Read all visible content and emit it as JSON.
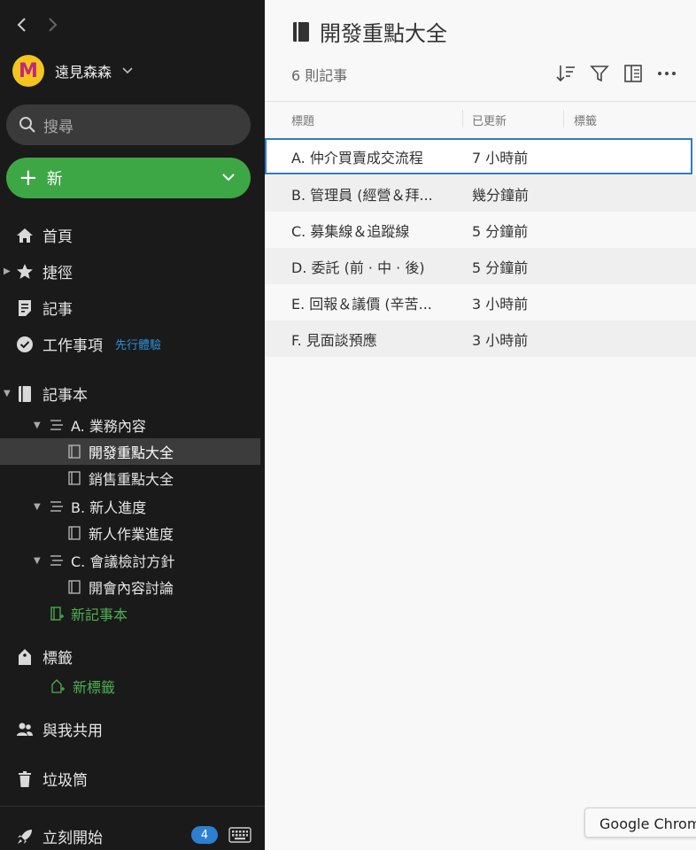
{
  "account": {
    "avatar_letter": "M",
    "name": "遠見森森"
  },
  "search": {
    "placeholder": "搜尋"
  },
  "new_button": {
    "label": "新"
  },
  "nav": {
    "home": "首頁",
    "shortcuts": "捷徑",
    "notes": "記事",
    "tasks": "工作事項",
    "tasks_beta": "先行體驗",
    "notebooks": "記事本",
    "tags": "標籤",
    "new_tag": "新標籤",
    "shared": "與我共用",
    "trash": "垃圾筒",
    "get_started": "立刻開始",
    "get_started_badge": "4"
  },
  "tree": {
    "stack_a": "A. 業務內容",
    "nb_a1": "開發重點大全",
    "nb_a2": "銷售重點大全",
    "stack_b": "B. 新人進度",
    "nb_b1": "新人作業進度",
    "stack_c": "C. 會議檢討方針",
    "nb_c1": "開會內容討論",
    "new_notebook": "新記事本"
  },
  "main": {
    "title": "開發重點大全",
    "note_count": "6 則記事",
    "columns": {
      "title": "標題",
      "updated": "已更新",
      "tags": "標籤"
    },
    "rows": [
      {
        "title": "A. 仲介買賣成交流程",
        "updated": "7 小時前"
      },
      {
        "title": "B. 管理員 (經營＆拜...",
        "updated": "幾分鐘前"
      },
      {
        "title": "C. 募集線＆追蹤線",
        "updated": "5 分鐘前"
      },
      {
        "title": "D. 委託 (前 · 中 · 後)",
        "updated": "5 分鐘前"
      },
      {
        "title": "E. 回報＆議價 (辛苦...",
        "updated": "3 小時前"
      },
      {
        "title": "F. 見面談預應",
        "updated": "3 小時前"
      }
    ]
  },
  "tooltip": {
    "text": "Google Chrome"
  },
  "colors": {
    "accent_green": "#3ea745",
    "selection_blue": "#2e7bc6",
    "sidebar_bg": "#1a1a1a"
  }
}
